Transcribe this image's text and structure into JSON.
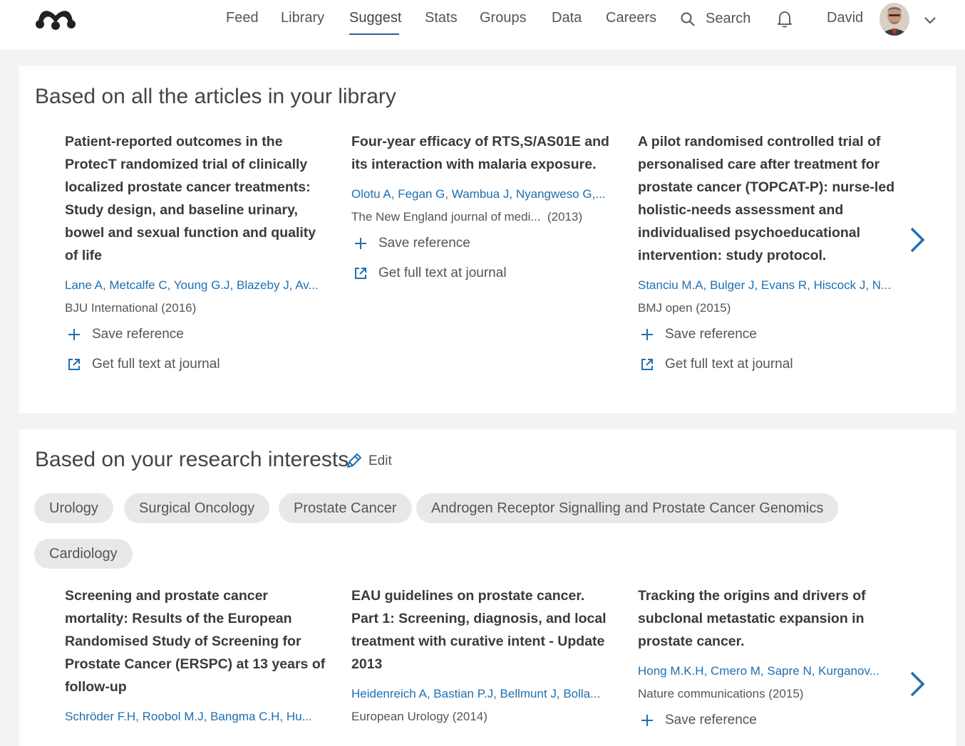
{
  "nav": {
    "items": [
      "Feed",
      "Library",
      "Suggest",
      "Stats",
      "Groups",
      "Data",
      "Careers"
    ],
    "active": "Suggest",
    "search_label": "Search",
    "user_name": "David"
  },
  "library_section": {
    "title": "Based on all the articles in your library",
    "articles": [
      {
        "title": "Patient-reported outcomes in the ProtecT randomized trial of clinically localized prostate cancer treatments: Study design, and baseline urinary, bowel and sexual function and quality of life",
        "authors": "Lane A, Metcalfe C, Young G.J, Blazeby J, Av...",
        "journal": "BJU International (2016)",
        "save": "Save reference",
        "fulltext": "Get full text at journal"
      },
      {
        "title": "Four-year efficacy of RTS,S/AS01E and its interaction with malaria exposure.",
        "authors": "Olotu A, Fegan G, Wambua J, Nyangweso G,...",
        "journal": "The New England journal of medi...  (2013)",
        "save": "Save reference",
        "fulltext": "Get full text at journal"
      },
      {
        "title": "A pilot randomised controlled trial of personalised care after treatment for prostate cancer (TOPCAT-P): nurse-led holistic-needs assessment and individualised psychoeducational intervention: study protocol.",
        "authors": "Stanciu M.A, Bulger J, Evans R, Hiscock J, N...",
        "journal": "BMJ open (2015)",
        "save": "Save reference",
        "fulltext": "Get full text at journal"
      }
    ]
  },
  "interests_section": {
    "title": "Based on your research interests",
    "edit_label": "Edit",
    "chips": [
      "Urology",
      "Surgical Oncology",
      "Prostate Cancer",
      "Androgen Receptor Signalling and Prostate Cancer Genomics",
      "Cardiology"
    ],
    "articles": [
      {
        "title": "Screening and prostate cancer mortality: Results of the European Randomised Study of Screening for Prostate Cancer (ERSPC) at 13 years of follow-up",
        "authors": "Schröder F.H, Roobol M.J, Bangma C.H, Hu..."
      },
      {
        "title": "EAU guidelines on prostate cancer. Part 1: Screening, diagnosis, and local treatment with curative intent - Update 2013",
        "authors": "Heidenreich A, Bastian P.J, Bellmunt J, Bolla...",
        "journal": "European Urology (2014)"
      },
      {
        "title": "Tracking the origins and drivers of subclonal metastatic expansion in prostate cancer.",
        "authors": "Hong M.K.H, Cmero M, Sapre N, Kurganov...",
        "journal": "Nature communications (2015)",
        "save": "Save reference"
      }
    ]
  },
  "colors": {
    "link": "#1f6fb0",
    "accent": "#2a5f8f",
    "chip_bg": "#e8e8e8"
  }
}
